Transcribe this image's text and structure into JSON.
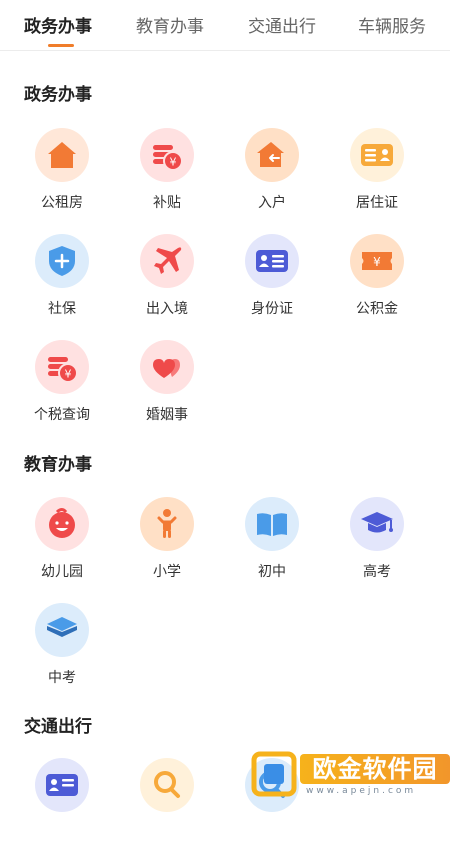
{
  "tabs": [
    "政务办事",
    "教育办事",
    "交通出行",
    "车辆服务"
  ],
  "active_tab": 0,
  "sections": [
    {
      "title": "政务办事",
      "items": [
        {
          "label": "公租房",
          "icon": "house-icon"
        },
        {
          "label": "补贴",
          "icon": "coins-yuan-icon"
        },
        {
          "label": "入户",
          "icon": "house-arrow-icon"
        },
        {
          "label": "居住证",
          "icon": "residence-card-icon"
        },
        {
          "label": "社保",
          "icon": "shield-plus-icon"
        },
        {
          "label": "出入境",
          "icon": "airplane-icon"
        },
        {
          "label": "身份证",
          "icon": "id-card-icon"
        },
        {
          "label": "公积金",
          "icon": "yuan-ticket-icon"
        },
        {
          "label": "个税查询",
          "icon": "coins-yuan-icon"
        },
        {
          "label": "婚姻事",
          "icon": "hearts-icon"
        }
      ]
    },
    {
      "title": "教育办事",
      "items": [
        {
          "label": "幼儿园",
          "icon": "baby-face-icon"
        },
        {
          "label": "小学",
          "icon": "child-icon"
        },
        {
          "label": "初中",
          "icon": "open-book-icon"
        },
        {
          "label": "高考",
          "icon": "graduation-cap-icon"
        },
        {
          "label": "中考",
          "icon": "layers-icon"
        }
      ]
    },
    {
      "title": "交通出行",
      "items": [
        {
          "label": "",
          "icon": "id-card-icon"
        },
        {
          "label": "",
          "icon": "search-icon"
        },
        {
          "label": "",
          "icon": "search-icon"
        }
      ]
    }
  ],
  "watermark": {
    "text": "欧金软件园",
    "url": "www.apejn.com"
  },
  "colors": {
    "accent": "#f07d2a",
    "orange": "#f27a35",
    "red": "#ef4a4a",
    "blue": "#4a9be8",
    "indigo": "#4d5bd6"
  }
}
